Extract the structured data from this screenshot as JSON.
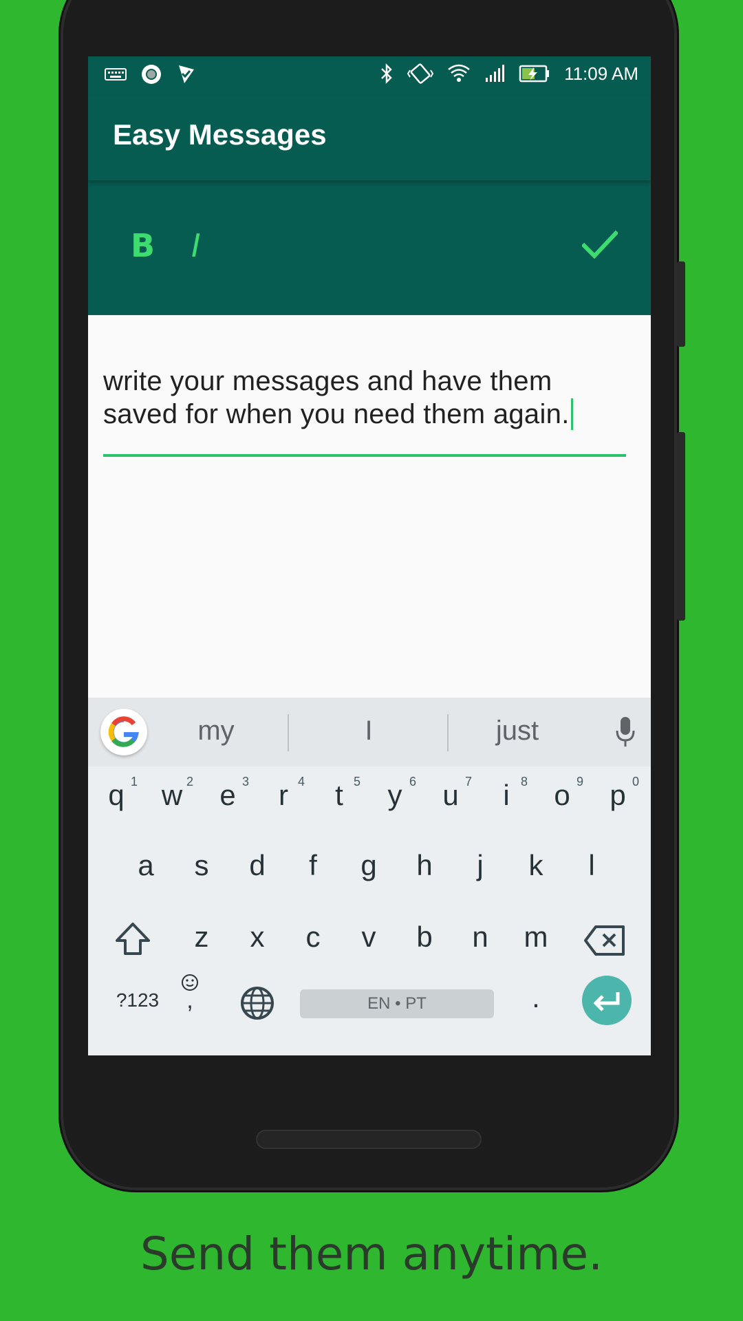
{
  "status_bar": {
    "time": "11:09 AM",
    "icons_left": [
      "keyboard-icon",
      "record-icon",
      "check-flag-icon"
    ],
    "icons_right": [
      "bluetooth-icon",
      "vibrate-icon",
      "wifi-icon",
      "signal-icon",
      "battery-charging-icon"
    ]
  },
  "app": {
    "title": "Easy Messages"
  },
  "toolbar": {
    "bold_label": "B",
    "italic_label": "I",
    "confirm_icon": "check-icon",
    "accent_color": "#3ddc6f",
    "bar_color": "#075c52"
  },
  "editor": {
    "text": "write your messages and have them saved for when you need them again."
  },
  "keyboard": {
    "suggestions": [
      "my",
      "I",
      "just"
    ],
    "row1": [
      {
        "k": "q",
        "h": "1"
      },
      {
        "k": "w",
        "h": "2"
      },
      {
        "k": "e",
        "h": "3"
      },
      {
        "k": "r",
        "h": "4"
      },
      {
        "k": "t",
        "h": "5"
      },
      {
        "k": "y",
        "h": "6"
      },
      {
        "k": "u",
        "h": "7"
      },
      {
        "k": "i",
        "h": "8"
      },
      {
        "k": "o",
        "h": "9"
      },
      {
        "k": "p",
        "h": "0"
      }
    ],
    "row2": [
      "a",
      "s",
      "d",
      "f",
      "g",
      "h",
      "j",
      "k",
      "l"
    ],
    "row3": [
      "z",
      "x",
      "c",
      "v",
      "b",
      "n",
      "m"
    ],
    "symbols_label": "?123",
    "comma_label": ",",
    "period_label": ".",
    "space_label": "EN • PT",
    "enter_color": "#4db6ac"
  },
  "caption": "Send them anytime.",
  "background_color": "#2fb82f"
}
